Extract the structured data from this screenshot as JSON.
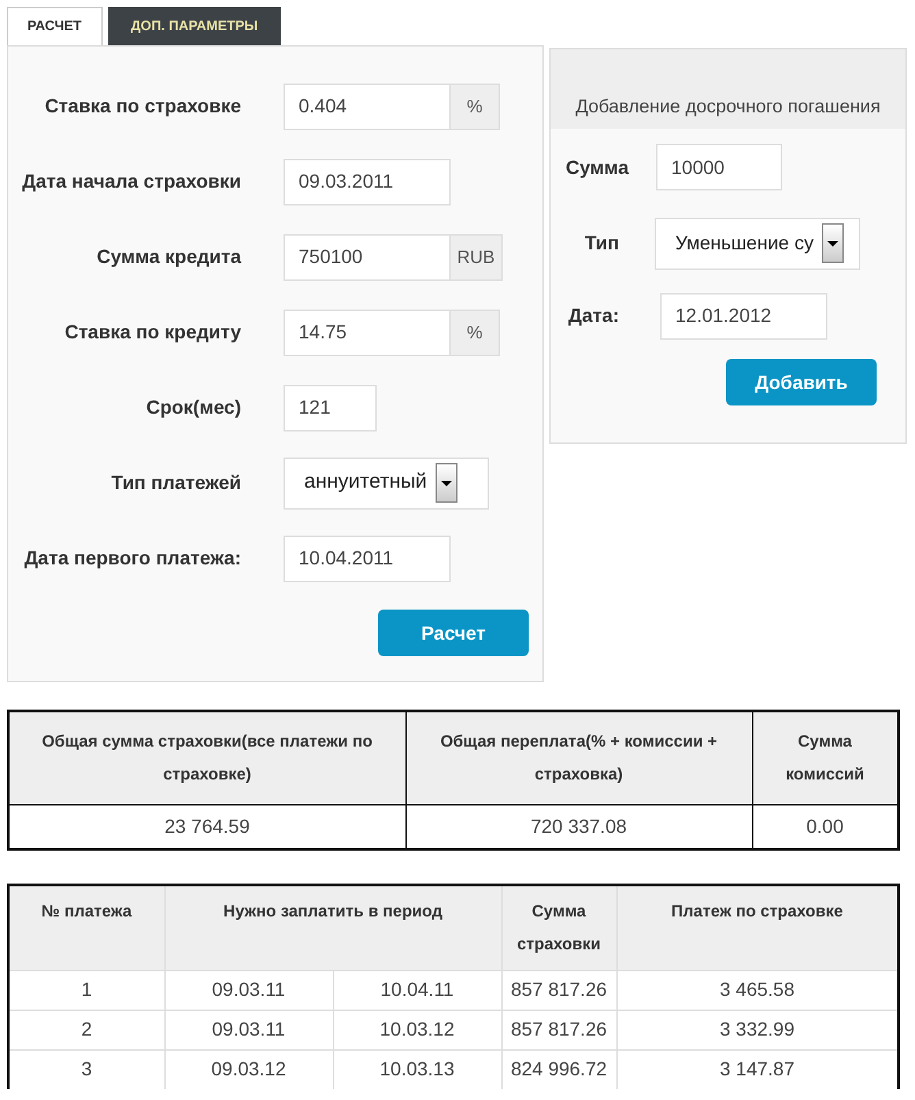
{
  "tabs": [
    {
      "label": "РАСЧЕТ",
      "selected": true
    },
    {
      "label": "ДОП. ПАРАМЕТРЫ",
      "selected": false
    }
  ],
  "calc_form": {
    "fields": [
      {
        "kind": "addon",
        "label": "Ставка по страховке",
        "value": "0.404",
        "addon": "%"
      },
      {
        "kind": "input",
        "label": "Дата начала страховки",
        "value": "09.03.2011"
      },
      {
        "kind": "addon",
        "label": "Сумма кредита",
        "value": "750100",
        "addon": "RUB"
      },
      {
        "kind": "addon",
        "label": "Ставка по кредиту",
        "value": "14.75",
        "addon": "%"
      },
      {
        "kind": "input",
        "label": "Срок(мес)",
        "value": "121"
      },
      {
        "kind": "select",
        "label": "Тип платежей",
        "value": "аннуитетный"
      },
      {
        "kind": "input",
        "label": "Дата первого платежа:",
        "value": "10.04.2011"
      }
    ],
    "button": "Расчет"
  },
  "prepayment": {
    "title": "Добавление досрочного погашения",
    "fields": [
      {
        "kind": "input",
        "label": "Сумма",
        "value": "10000"
      },
      {
        "kind": "select",
        "label": "Тип",
        "value": "Уменьшение су"
      },
      {
        "kind": "input",
        "label": "Дата:",
        "value": "12.01.2012"
      }
    ],
    "button": "Добавить"
  },
  "summary": {
    "columns": [
      "Общая сумма страховки(все платежи по страховке)",
      "Общая переплата(% + комиссии + страховка)",
      "Сумма комиссий"
    ],
    "row": [
      "23 764.59",
      "720 337.08",
      "0.00"
    ]
  },
  "schedule": {
    "columns": [
      "№ платежа",
      "Нужно заплатить в период",
      "Сумма страховки",
      "Платеж по страховке"
    ],
    "rows": [
      {
        "number": "1",
        "period": [
          "09.03.11",
          "10.04.11"
        ],
        "insurance_sum": "857 817.26",
        "insurance_payment": "3 465.58"
      },
      {
        "number": "2",
        "period": [
          "09.03.11",
          "10.03.12"
        ],
        "insurance_sum": "857 817.26",
        "insurance_payment": "3 332.99"
      },
      {
        "number": "3",
        "period": [
          "09.03.12",
          "10.03.13"
        ],
        "insurance_sum": "824 996.72",
        "insurance_payment": "3 147.87"
      }
    ]
  }
}
